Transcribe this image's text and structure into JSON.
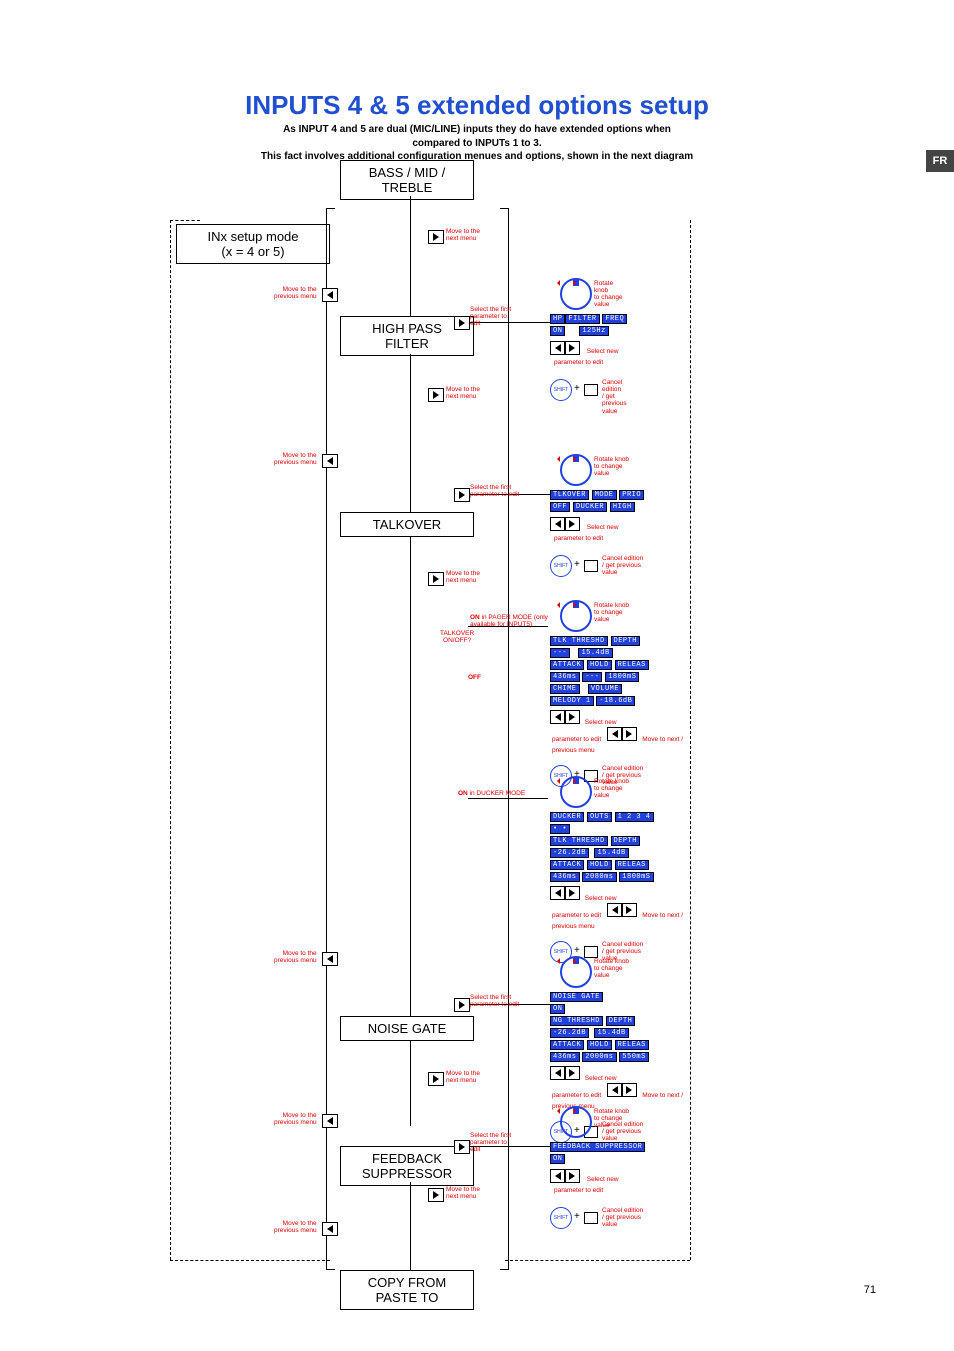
{
  "page": {
    "title": "INPUTS 4 & 5 extended options setup",
    "sub1": "As INPUT 4 and 5 are dual (MIC/LINE) inputs they do have extended options when",
    "sub2": "compared to INPUTs 1 to 3.",
    "sub3": "This fact involves additional configuration menues and options, shown in the next diagram",
    "langTab": "FR",
    "number": "71"
  },
  "boxes": {
    "inx1": "INx setup mode",
    "inx2": "(x = 4 or 5)",
    "bmt1": "BASS / MID /",
    "bmt2": "TREBLE",
    "hpf1": "HIGH PASS",
    "hpf2": "FILTER",
    "talk": "TALKOVER",
    "ng": "NOISE GATE",
    "fb1": "FEEDBACK",
    "fb2": "SUPPRESSOR",
    "cp1": "COPY FROM",
    "cp2": "PASTE TO"
  },
  "labels": {
    "moveNext1": "Move to the",
    "moveNext2": "next menu",
    "movePrev1": "Move to the",
    "movePrev2": "previous menu",
    "selFirst1": "Select the first",
    "selFirst2": "parameter to",
    "selFirst3": "edit",
    "selFirst2a": "parameter to edit",
    "rotate1": "Rotate knob",
    "rotate2": "to change",
    "rotate3": "value",
    "selNew1": "Select new",
    "selNew2": "parameter to edit",
    "moveNP1": "Move to next /",
    "moveNP2": "previous menu",
    "cancel1": "Cancel edition",
    "cancel2": "/ get previous",
    "cancel3": "value",
    "shift": "SHIFT",
    "tkoo1": "TALKOVER",
    "tkoo2": "ON/OFF?",
    "onPager1": "ON",
    "onPager2": "in PAGER MODE (only",
    "onPager3": "available for INPUT5)",
    "off": "OFF",
    "onDucker1": "ON",
    "onDucker2": "in DUCKER MODE"
  },
  "lcd": {
    "hpf": {
      "l1a": "HP",
      "l1b": "FILTER",
      "l1c": "FREQ",
      "l2a": "ON",
      "l2b": "125Hz"
    },
    "talk": {
      "l1a": "TLKOVER",
      "l1b": "MODE",
      "l1c": "PRIO",
      "l2a": "OFF",
      "l2b": "DUCKER",
      "l2c": "HIGH"
    },
    "pager": {
      "l1a": "TLK THRESHD",
      "l1b": "DEPTH",
      "l2a": "---",
      "l2b": "15.4dB",
      "l3a": "ATTACK",
      "l3b": "HOLD",
      "l3c": "RELEAS",
      "l4a": "436ms",
      "l4b": "---",
      "l4c": "1800mS",
      "l5a": "CHIME",
      "l5b": "VOLUME",
      "l6a": "MELODY 1",
      "l6b": "-18.6dB"
    },
    "duck": {
      "l1a": "DUCKER",
      "l1b": "OUTS",
      "l1c": "1 2 3 4",
      "l2a": "• •",
      "l3a": "TLK THRESHD",
      "l3b": "DEPTH",
      "l4a": "-26.2dB",
      "l4b": "15.4dB",
      "l5a": "ATTACK",
      "l5b": "HOLD",
      "l5c": "RELEAS",
      "l6a": "436ms",
      "l6b": "2080ms",
      "l6c": "1800mS"
    },
    "ng": {
      "l1a": "NOISE GATE",
      "l2a": "ON",
      "l3a": "NG THRESHD",
      "l3b": "DEPTH",
      "l4a": "-26.2dB",
      "l4b": "15.4dB",
      "l5a": "ATTACK",
      "l5b": "HOLD",
      "l5c": "RELEAS",
      "l6a": "436ms",
      "l6b": "2000ms",
      "l6c": "550mS"
    },
    "fb": {
      "l1a": "FEEDBACK SUPPRESSOR",
      "l2a": "ON"
    }
  }
}
